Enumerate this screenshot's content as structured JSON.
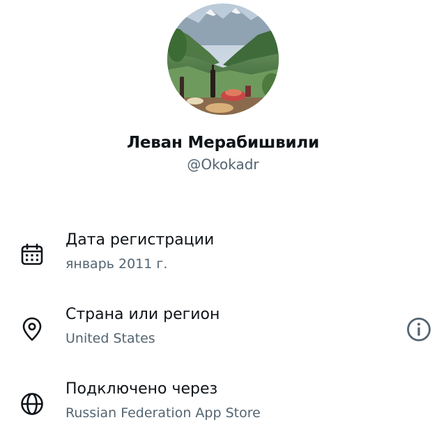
{
  "profile": {
    "name": "Леван Мерабишвили",
    "handle": "@Okokadr"
  },
  "rows": [
    {
      "icon": "calendar-icon",
      "title": "Дата регистрации",
      "value": "январь 2011 г."
    },
    {
      "icon": "location-pin-icon",
      "title": "Страна или регион",
      "value": "United States",
      "action_icon": "info-icon"
    },
    {
      "icon": "globe-icon",
      "title": "Подключено через",
      "value": "Russian Federation App Store"
    }
  ],
  "colors": {
    "text_primary": "#0f1419",
    "text_secondary": "#536471",
    "background": "#ffffff"
  }
}
